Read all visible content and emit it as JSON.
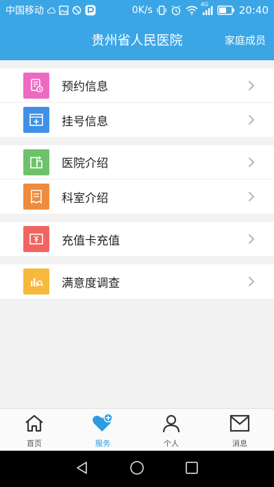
{
  "status_bar": {
    "carrier": "中国移动",
    "speed": "0K/s",
    "network": "4G",
    "time": "20:40"
  },
  "header": {
    "title": "贵州省人民医院",
    "family_label": "家庭成员"
  },
  "groups": [
    [
      {
        "label": "预约信息",
        "icon": "appointment-icon",
        "color": "#ee6ac2"
      },
      {
        "label": "挂号信息",
        "icon": "registration-icon",
        "color": "#3f90e6"
      }
    ],
    [
      {
        "label": "医院介绍",
        "icon": "hospital-icon",
        "color": "#6cc26a"
      },
      {
        "label": "科室介绍",
        "icon": "department-icon",
        "color": "#ef8b3c"
      }
    ],
    [
      {
        "label": "充值卡充值",
        "icon": "recharge-icon",
        "color": "#f2645f"
      }
    ],
    [
      {
        "label": "满意度调查",
        "icon": "survey-icon",
        "color": "#f6b93b"
      }
    ]
  ],
  "tabs": [
    {
      "label": "首页",
      "icon": "home-icon",
      "active": false
    },
    {
      "label": "服务",
      "icon": "heart-plus-icon",
      "active": true
    },
    {
      "label": "个人",
      "icon": "person-icon",
      "active": false
    },
    {
      "label": "消息",
      "icon": "message-icon",
      "active": false
    }
  ],
  "colors": {
    "primary": "#3aa6e6",
    "tab_active": "#2c9be0"
  }
}
